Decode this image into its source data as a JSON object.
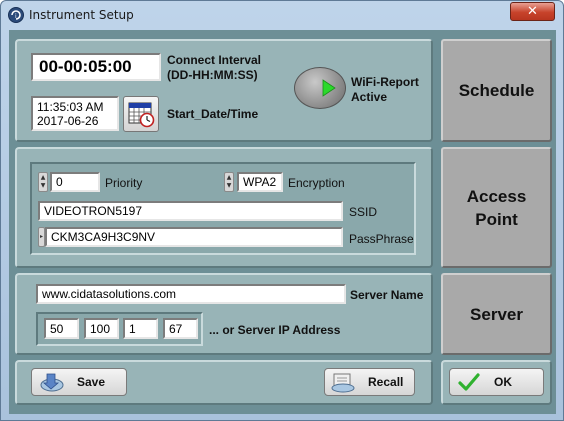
{
  "window": {
    "title": "Instrument Setup",
    "close_symbol": "✕"
  },
  "schedule": {
    "connect_interval_value": "00-00:05:00",
    "connect_interval_label": "Connect Interval",
    "connect_interval_format": "(DD-HH:MM:SS)",
    "start_time": "11:35:03 AM",
    "start_date": "2017-06-26",
    "start_label": "Start_Date/Time",
    "wifi_label_line1": "WiFi-Report",
    "wifi_label_line2": "Active",
    "wifi_active": true
  },
  "access_point": {
    "priority_value": "0",
    "priority_label": "Priority",
    "encryption_value": "WPA2",
    "encryption_label": "Encryption",
    "ssid_value": "VIDEOTRON5197",
    "ssid_label": "SSID",
    "passphrase_value": "CKM3CA9H3C9NV",
    "passphrase_label": "PassPhrase"
  },
  "server": {
    "name_value": "www.cidatasolutions.com",
    "name_label": "Server Name",
    "ip_octets": [
      "50",
      "100",
      "1",
      "67"
    ],
    "ip_label": "... or Server IP Address"
  },
  "side_buttons": {
    "schedule": "Schedule",
    "access_point_line1": "Access",
    "access_point_line2": "Point",
    "server": "Server"
  },
  "footer": {
    "save_label": "Save",
    "recall_label": "Recall",
    "ok_label": "OK"
  },
  "colors": {
    "client_bg": "#6d8f96",
    "panel_bg": "#98b4b7",
    "side_button_bg": "#a9a9a9",
    "wifi_indicator": "#2bd92b"
  }
}
